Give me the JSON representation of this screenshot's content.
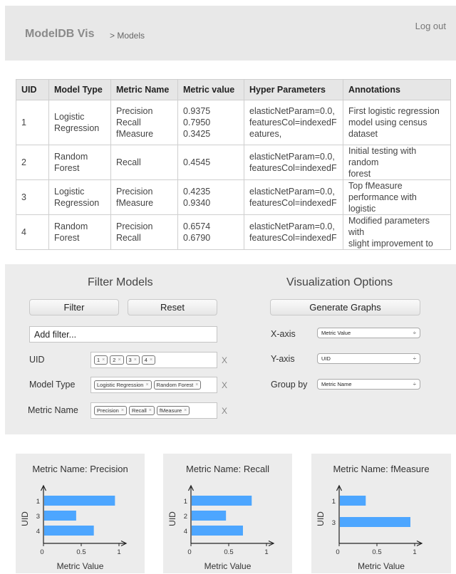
{
  "header": {
    "brand": "ModelDB Vis",
    "breadcrumb": "> Models",
    "logout": "Log out"
  },
  "table": {
    "columns": [
      "UID",
      "Model Type",
      "Metric Name",
      "Metric value",
      "Hyper Parameters",
      "Annotations"
    ],
    "rows": [
      {
        "uid": "1",
        "model_type": [
          "Logistic",
          "Regression"
        ],
        "metric_names": [
          "Precision",
          "Recall",
          "fMeasure"
        ],
        "metric_values": [
          "0.9375",
          "0.7950",
          "0.3425"
        ],
        "hyper_params": [
          "elasticNetParam=0.0,",
          "featuresCol=indexedF",
          "eatures,"
        ],
        "annotations": [
          "First logistic regression",
          "model using census",
          "dataset"
        ]
      },
      {
        "uid": "2",
        "model_type": [
          "Random",
          "Forest"
        ],
        "metric_names": [
          "Recall"
        ],
        "metric_values": [
          "0.4545"
        ],
        "hyper_params": [
          "elasticNetParam=0.0,",
          "featuresCol=indexedF"
        ],
        "annotations": [
          "Initial testing with random",
          "forest"
        ]
      },
      {
        "uid": "3",
        "model_type": [
          "Logistic",
          "Regression"
        ],
        "metric_names": [
          "Precision",
          "fMeasure"
        ],
        "metric_values": [
          "0.4235",
          "0.9340"
        ],
        "hyper_params": [
          "elasticNetParam=0.0,",
          "featuresCol=indexedF"
        ],
        "annotations": [
          "Top fMeasure",
          "performance with logistic"
        ]
      },
      {
        "uid": "4",
        "model_type": [
          "Random",
          "Forest"
        ],
        "metric_names": [
          "Precision",
          "Recall"
        ],
        "metric_values": [
          "0.6574",
          "0.6790"
        ],
        "hyper_params": [
          "elasticNetParam=0.0,",
          "featuresCol=indexedF"
        ],
        "annotations": [
          "Modified parameters with",
          "slight improvement to"
        ]
      }
    ]
  },
  "filters": {
    "title": "Filter Models",
    "filter_button": "Filter",
    "reset_button": "Reset",
    "add_filter_value": "Add filter...",
    "uid_label": "UID",
    "uid_tags": [
      "1",
      "2",
      "3",
      "4"
    ],
    "model_type_label": "Model Type",
    "model_type_tags": [
      "Logistic Regression",
      "Random Forest"
    ],
    "metric_name_label": "Metric Name",
    "metric_name_tags": [
      "Precision",
      "Recall",
      "fMeasure"
    ],
    "clear_glyph": "X",
    "tag_remove_glyph": "×"
  },
  "visualization": {
    "title": "Visualization Options",
    "generate_button": "Generate Graphs",
    "x_axis_label": "X-axis",
    "x_axis_value": "Metric Value",
    "y_axis_label": "Y-axis",
    "y_axis_value": "UID",
    "group_by_label": "Group by",
    "group_by_value": "Metric Name",
    "select_arrow": "÷"
  },
  "chart_data": [
    {
      "type": "bar",
      "title": "Metric Name: Precision",
      "xlabel": "Metric Value",
      "ylabel": "UID",
      "categories": [
        "1",
        "3",
        "4"
      ],
      "values": [
        0.9375,
        0.4235,
        0.6574
      ],
      "xlim": [
        0,
        1
      ],
      "xticks": [
        "0",
        "0.5",
        "1"
      ],
      "color": "#4da6ff"
    },
    {
      "type": "bar",
      "title": "Metric Name: Recall",
      "xlabel": "Metric Value",
      "ylabel": "UID",
      "categories": [
        "1",
        "2",
        "4"
      ],
      "values": [
        0.795,
        0.4545,
        0.679
      ],
      "xlim": [
        0,
        1
      ],
      "xticks": [
        "0",
        "0.5",
        "1"
      ],
      "color": "#4da6ff"
    },
    {
      "type": "bar",
      "title": "Metric Name: fMeasure",
      "xlabel": "Metric Value",
      "ylabel": "UID",
      "categories": [
        "1",
        "3"
      ],
      "values": [
        0.3425,
        0.934
      ],
      "xlim": [
        0,
        1
      ],
      "xticks": [
        "0",
        "0.5",
        "1"
      ],
      "color": "#4da6ff"
    }
  ]
}
